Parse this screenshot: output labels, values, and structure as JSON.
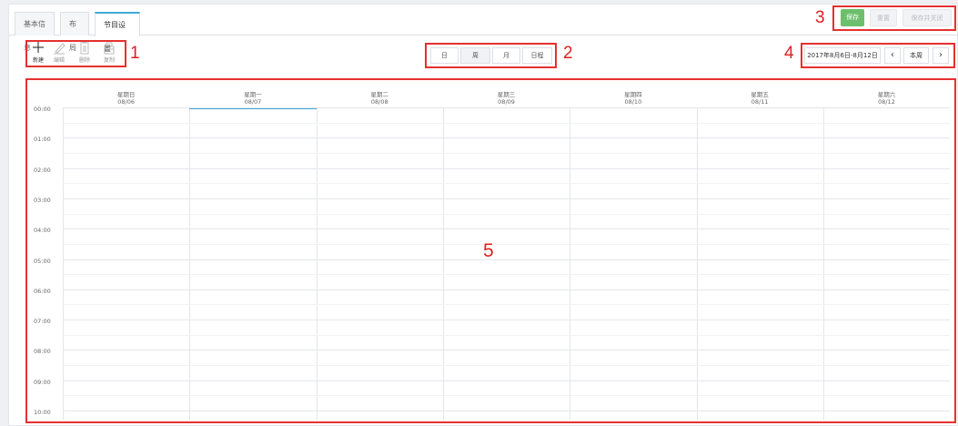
{
  "tabs": [
    {
      "label": "基本信息",
      "active": false
    },
    {
      "label": "布局",
      "active": false
    },
    {
      "label": "节目设置",
      "active": true
    }
  ],
  "actions": {
    "save": "保存",
    "reset": "重置",
    "save_close": "保存并关闭"
  },
  "toolbar": [
    {
      "label": "新建",
      "icon": "plus-icon",
      "enabled": true
    },
    {
      "label": "编辑",
      "icon": "edit-icon",
      "enabled": false
    },
    {
      "label": "删除",
      "icon": "trash-icon",
      "enabled": false
    },
    {
      "label": "复制",
      "icon": "copy-icon",
      "enabled": false
    }
  ],
  "views": [
    {
      "label": "日",
      "active": false
    },
    {
      "label": "周",
      "active": true
    },
    {
      "label": "月",
      "active": false
    },
    {
      "label": "日程",
      "active": false
    }
  ],
  "date_nav": {
    "range": "2017年8月6日-8月12日",
    "prev": "‹",
    "this_week": "本周",
    "next": "›"
  },
  "days": [
    {
      "name": "星期日",
      "date": "08/06"
    },
    {
      "name": "星期一",
      "date": "08/07",
      "today": true
    },
    {
      "name": "星期二",
      "date": "08/08"
    },
    {
      "name": "星期三",
      "date": "08/09"
    },
    {
      "name": "星期四",
      "date": "08/10"
    },
    {
      "name": "星期五",
      "date": "08/11"
    },
    {
      "name": "星期六",
      "date": "08/12"
    }
  ],
  "hours": [
    "00:00",
    "01:00",
    "02:00",
    "03:00",
    "04:00",
    "05:00",
    "06:00",
    "07:00",
    "08:00",
    "09:00",
    "10:00"
  ],
  "annotations": [
    "1",
    "2",
    "3",
    "4",
    "5"
  ],
  "colors": {
    "accent": "#3fa9d8",
    "save": "#6dbf6d",
    "annotation": "#e63030"
  }
}
